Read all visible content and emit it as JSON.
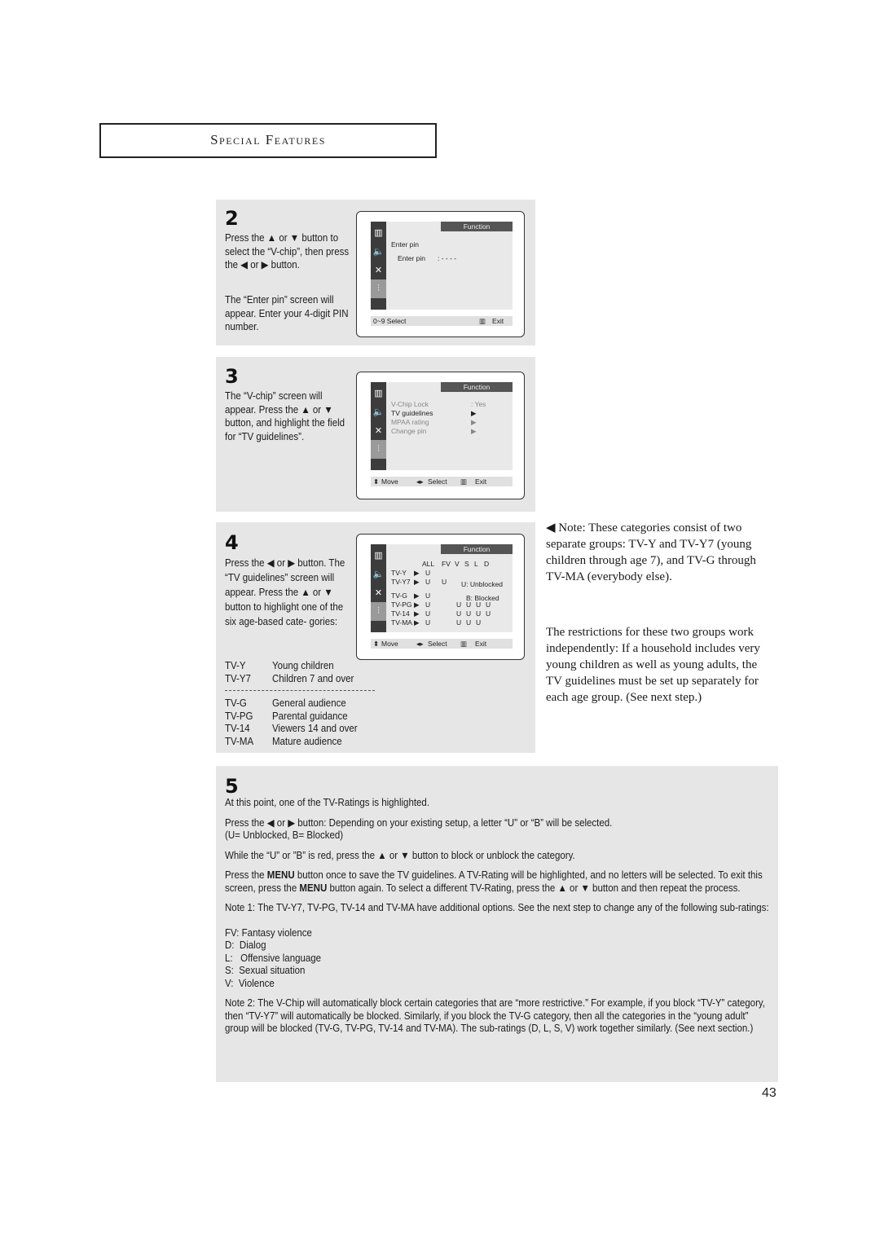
{
  "header": {
    "title": "Special Features"
  },
  "glyphs": {
    "up": "▲",
    "down": "▼",
    "left": "◀",
    "right": "▶",
    "updown": "⬍",
    "leftright": "◂▸",
    "menu_icon": "Ⅲ"
  },
  "step2": {
    "number": "2",
    "text1": "Press the ▲ or ▼ button to select  the “V-chip”, then press the ◀ or ▶ button.",
    "text2": "The “Enter pin” screen will appear. Enter your 4-digit PIN number.",
    "screen": {
      "function_label": "Function",
      "title": "Enter pin",
      "field_label": "Enter pin",
      "field_value": ":   -  -  -  -",
      "footer_left": "0~9  Select",
      "footer_right": "Exit"
    }
  },
  "step3": {
    "number": "3",
    "text": "The “V-chip” screen will appear. Press the ▲ or ▼ button, and highlight the field for “TV guidelines”.",
    "screen": {
      "function_label": "Function",
      "items": [
        {
          "label": "V-Chip Lock",
          "value": ":    Yes",
          "dim": true
        },
        {
          "label": "TV guidelines",
          "value": "▶",
          "dim": false
        },
        {
          "label": "MPAA rating",
          "value": "▶",
          "dim": true
        },
        {
          "label": "Change pin",
          "value": "▶",
          "dim": true
        }
      ],
      "footer_move": "Move",
      "footer_select": "Select",
      "footer_exit": "Exit"
    }
  },
  "step4": {
    "number": "4",
    "text": "Press the ◀ or ▶ button. The “TV guidelines” screen will appear. Press the ▲ or ▼ button to highlight one of the six age-based cate- gories:",
    "ratings_young": [
      {
        "code": "TV-Y",
        "desc": "Young children"
      },
      {
        "code": "TV-Y7",
        "desc": "Children 7 and over"
      }
    ],
    "ratings_general": [
      {
        "code": "TV-G",
        "desc": "General audience"
      },
      {
        "code": "TV-PG",
        "desc": "Parental guidance"
      },
      {
        "code": "TV-14",
        "desc": "Viewers 14 and over"
      },
      {
        "code": "TV-MA",
        "desc": "Mature audience"
      }
    ],
    "screen": {
      "function_label": "Function",
      "columns": [
        "ALL",
        "FV",
        "V",
        "S",
        "L",
        "D"
      ],
      "rows": [
        {
          "label": "TV-Y",
          "all": "U",
          "fv": "",
          "v": "",
          "s": "",
          "l": "",
          "d": ""
        },
        {
          "label": "TV-Y7",
          "all": "U",
          "fv": "U",
          "v": "",
          "s": "",
          "l": "",
          "d": ""
        },
        {
          "label": "TV-G",
          "all": "U",
          "fv": "",
          "v": "",
          "s": "",
          "l": "",
          "d": ""
        },
        {
          "label": "TV-PG",
          "all": "U",
          "fv": "",
          "v": "U",
          "s": "U",
          "l": "U",
          "d": "U"
        },
        {
          "label": "TV-14",
          "all": "U",
          "fv": "",
          "v": "U",
          "s": "U",
          "l": "U",
          "d": "U"
        },
        {
          "label": "TV-MA",
          "all": "U",
          "fv": "",
          "v": "U",
          "s": "U",
          "l": "U",
          "d": ""
        }
      ],
      "legend_unblocked": "U: Unblocked",
      "legend_blocked": "B: Blocked",
      "footer_move": "Move",
      "footer_select": "Select",
      "footer_exit": "Exit"
    }
  },
  "side_note": {
    "note": "◀ Note: These categories consist of two separate groups: TV-Y and TV-Y7 (young children through age 7), and TV-G through TV-MA (everybody else).",
    "restrictions": "The restrictions for these two groups work independently: If a household includes very young children as well as young adults, the TV guidelines must be set up separately for each age group. (See next step.)"
  },
  "step5": {
    "number": "5",
    "p1": "At this point, one of the TV-Ratings is highlighted.",
    "p2a": "Press the ◀ or ▶ button: Depending on your existing setup, a letter “U” or “B” will be selected.",
    "p2b": "(U= Unblocked, B= Blocked)",
    "p3": "While the “U” or ”B” is red, press the ▲ or ▼ button to block or unblock the category.",
    "p4_pre": "Press the ",
    "p4_menu": "MENU",
    "p4_mid": " button once to save the TV guidelines.  A TV-Rating will be highlighted, and no letters will be selected. To exit this screen, press the ",
    "p4_menu2": "MENU",
    "p4_post": " button again. To select a different TV-Rating, press the ▲ or ▼ button  and then repeat the process.",
    "note1": "Note 1: The TV-Y7, TV-PG, TV-14 and TV-MA have additional options.  See the next step to change any of the following sub-ratings:",
    "subratings": [
      "FV: Fantasy violence",
      "D:  Dialog",
      "L:   Offensive language",
      "S:  Sexual situation",
      "V:  Violence"
    ],
    "note2": "Note 2: The V-Chip will automatically block certain categories that are “more restrictive.” For example, if you block “TV-Y” category, then “TV-Y7” will automatically be blocked. Similarly, if you block the TV-G category, then all the categories in the “young adult” group will be blocked (TV-G, TV-PG, TV-14 and TV-MA). The sub-ratings (D, L, S, V) work together similarly. (See next section.)"
  },
  "page_number": "43"
}
